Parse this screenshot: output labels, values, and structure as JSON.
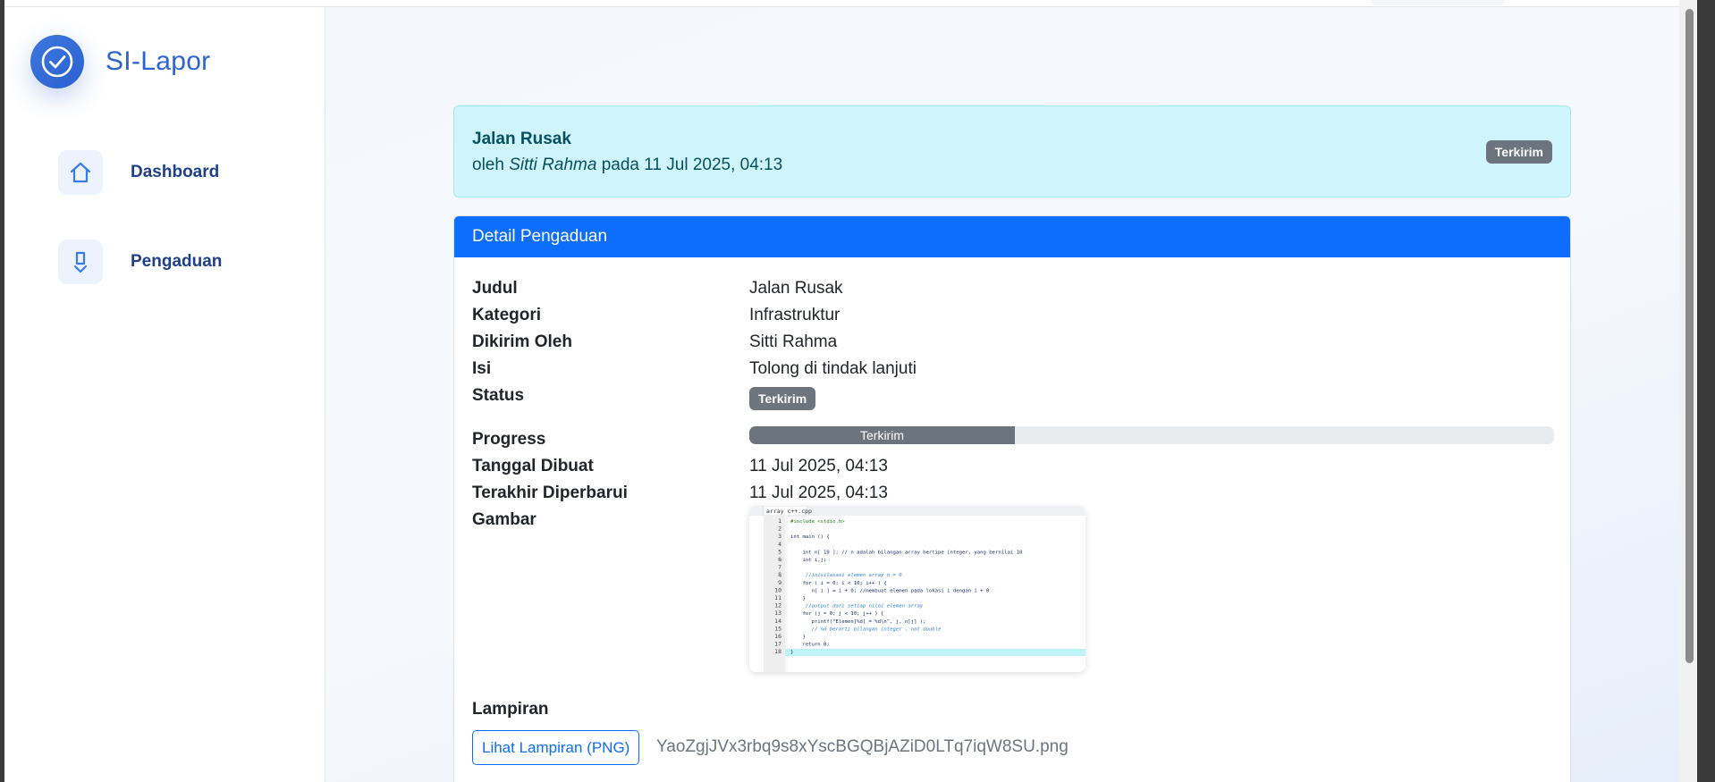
{
  "brand": {
    "name": "SI-Lapor",
    "logo_icon": "check-circle-icon",
    "color": "#2d63d2"
  },
  "sidebar": {
    "items": [
      {
        "label": "Dashboard",
        "icon": "home-icon"
      },
      {
        "label": "Pengaduan",
        "icon": "report-down-icon"
      }
    ]
  },
  "alert": {
    "title": "Jalan Rusak",
    "prefix": "oleh",
    "author": "Sitti Rahma",
    "connector": "pada",
    "date": "11 Jul 2025, 04:13",
    "badge": "Terkirim"
  },
  "detail": {
    "header": "Detail Pengaduan",
    "labels": {
      "judul": "Judul",
      "kategori": "Kategori",
      "dikirim_oleh": "Dikirim Oleh",
      "isi": "Isi",
      "status": "Status",
      "progress": "Progress",
      "tanggal_dibuat": "Tanggal Dibuat",
      "terakhir_diperbarui": "Terakhir Diperbarui",
      "gambar": "Gambar",
      "lampiran": "Lampiran"
    },
    "values": {
      "judul": "Jalan Rusak",
      "kategori": "Infrastruktur",
      "dikirim_oleh": "Sitti Rahma",
      "isi": "Tolong di tindak lanjuti",
      "status": "Terkirim",
      "progress_label": "Terkirim",
      "progress_fraction": 0.33,
      "tanggal_dibuat": "11 Jul 2025, 04:13",
      "terakhir_diperbarui": "11 Jul 2025, 04:13"
    },
    "attachment": {
      "button_label": "Lihat Lampiran (PNG)",
      "filename": "YaoZgjJVx3rbq9s8xYscBGQBjAZiD0LTq7iqW8SU.png"
    }
  },
  "image_preview": {
    "tab_label": "array c++.cpp",
    "line_numbers": [
      "1",
      "2",
      "3",
      "4",
      "5",
      "6",
      "7",
      "8",
      "9",
      "10",
      "11",
      "12",
      "13",
      "14",
      "15",
      "16",
      "17",
      "18"
    ],
    "code_lines": [
      "#include <stdio.h>",
      "",
      "int main () {",
      "",
      "    int n[ 10 ]; // n adalah bilangan array bertipe integer, yang bernilai 10",
      "    int i,j;",
      "",
      "     //inisilasasi elemen array n = 0",
      "    for ( i = 0; i < 10; i++ ) {",
      "       n[ i ] = i + 0; //membuat elemen pada lokasi i dengan i + 0",
      "    }",
      "     //output dari setiap nilai elemen array",
      "    for (j = 0; j < 10; j++ ) {",
      "       printf(\"Elemen[%d] = %d\\n\", j, n[j] );",
      "       // %d berarti bilangan integer , not double",
      "    }",
      "    return 0;",
      "}"
    ]
  },
  "colors": {
    "primary": "#0d6efd",
    "alert_bg": "#cff4fc",
    "badge_secondary": "#6c757d",
    "sidebar_text": "#1e3f8a"
  }
}
